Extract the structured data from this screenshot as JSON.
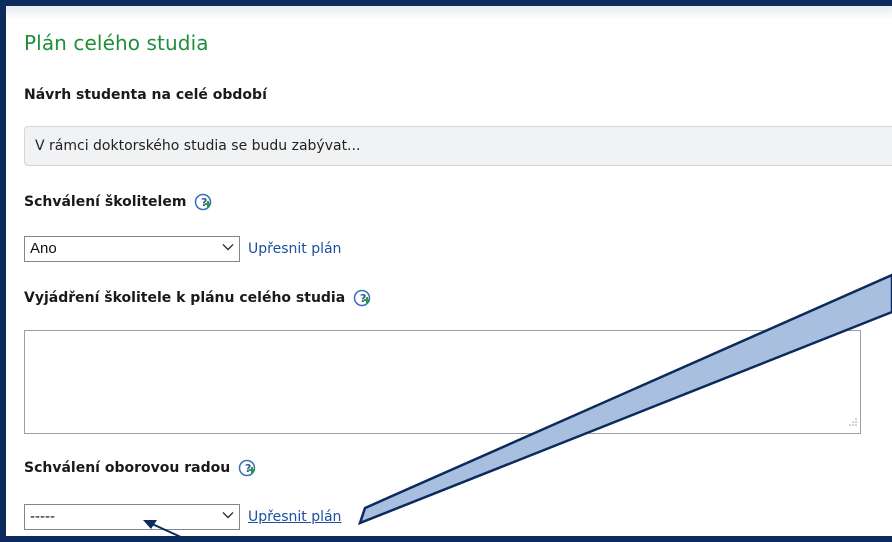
{
  "section": {
    "title": "Plán celého studia"
  },
  "student_proposal": {
    "label": "Návrh studenta na celé období",
    "value": "V rámci doktorského studia se budu zabývat..."
  },
  "supervisor_approval": {
    "label": "Schválení školitelem",
    "help_icon": "help-plus-icon",
    "select_value": "Ano",
    "link": "Upřesnit plán"
  },
  "supervisor_statement": {
    "label": "Vyjádření školitele k plánu celého studia",
    "help_icon": "help-plus-icon",
    "value": ""
  },
  "board_approval": {
    "label": "Schválení oborovou radou",
    "help_icon": "help-plus-icon",
    "select_value": "-----",
    "link": "Upřesnit plán"
  },
  "colors": {
    "title_green": "#1f8f3a",
    "link_blue": "#1d4fa0",
    "frame_navy": "#0d2a5c",
    "callout_fill": "#a8bfe0"
  }
}
